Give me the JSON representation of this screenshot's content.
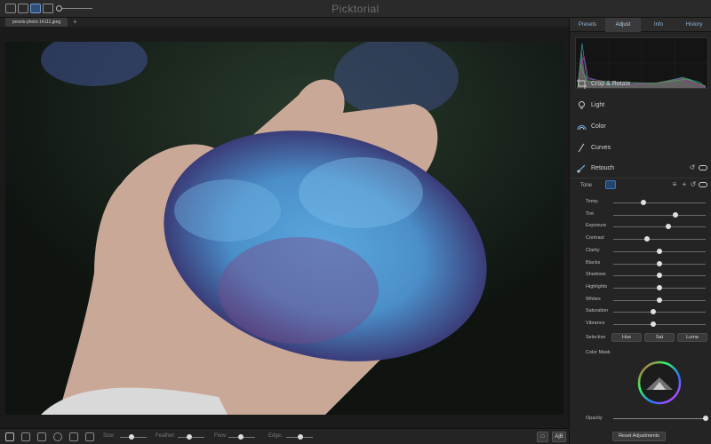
{
  "app": {
    "title": "Picktorial",
    "tab_name": "pexels-photo-14111.jpeg",
    "tab_add": "+"
  },
  "panel": {
    "tabs": [
      {
        "label": "Presets",
        "active": false
      },
      {
        "label": "Adjust",
        "active": true
      },
      {
        "label": "Info",
        "active": false
      },
      {
        "label": "History",
        "active": false
      }
    ],
    "sections": [
      {
        "label": "Crop & Rotate",
        "icon": "crop-icon"
      },
      {
        "label": "Light",
        "icon": "bulb-icon"
      },
      {
        "label": "Color",
        "icon": "rainbow-icon"
      },
      {
        "label": "Curves",
        "icon": "curve-icon"
      },
      {
        "label": "Retouch",
        "icon": "brush-icon"
      }
    ],
    "tone_label": "Tone",
    "sliders": [
      {
        "label": "Temp.",
        "value": 0.33
      },
      {
        "label": "Tint",
        "value": 0.67
      },
      {
        "label": "Exposure",
        "value": 0.6
      },
      {
        "label": "Contrast",
        "value": 0.37
      },
      {
        "label": "Clarity",
        "value": 0.5
      },
      {
        "label": "Blacks",
        "value": 0.5
      },
      {
        "label": "Shadows",
        "value": 0.5
      },
      {
        "label": "Highlights",
        "value": 0.5
      },
      {
        "label": "Whites",
        "value": 0.5
      },
      {
        "label": "Saturation",
        "value": 0.43
      },
      {
        "label": "Vibrance",
        "value": 0.43
      }
    ],
    "selective": {
      "label": "Selective",
      "buttons": [
        "Hue",
        "Sat",
        "Luma"
      ]
    },
    "color_mask_label": "Color Mask",
    "opacity_label": "Opacity",
    "opacity_value": 1.0,
    "reset_label": "Reset Adjustments"
  },
  "bottombar": {
    "size_label": "Size:",
    "feather_label": "Feather:",
    "flow_label": "Flow:",
    "edge_label": "Edge:",
    "ab_label": "A|B"
  },
  "colors": {
    "accent": "#3a77c4",
    "tab_text": "#8fb6d8"
  }
}
